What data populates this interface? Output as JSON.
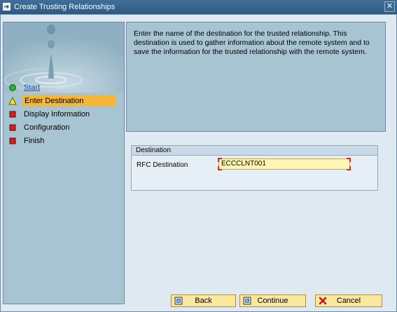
{
  "window": {
    "title": "Create Trusting Relationships",
    "close_symbol": "✕"
  },
  "steps": [
    {
      "label": "Start",
      "state": "link",
      "icon": "green-circle-icon"
    },
    {
      "label": "Enter Destination",
      "state": "active",
      "icon": "yellow-triangle-icon"
    },
    {
      "label": "Display Information",
      "state": "pending",
      "icon": "red-square-icon"
    },
    {
      "label": "Configuration",
      "state": "pending",
      "icon": "red-square-icon"
    },
    {
      "label": "Finish",
      "state": "pending",
      "icon": "red-square-icon"
    }
  ],
  "info": {
    "text": "Enter the name of the destination for the trusted relationship. This destination is used to gather information about the remote system and to save the information for the trusted relationship with the remote system."
  },
  "destination_group": {
    "header": "Destination",
    "rfc_label": "RFC Destination",
    "rfc_value": "ECCCLNT001"
  },
  "buttons": {
    "back": "Back",
    "continue": "Continue",
    "cancel": "Cancel"
  },
  "colors": {
    "active_step": "#f4b73b",
    "panel": "#a7c4d3",
    "button": "#fbe8a0",
    "input": "#fdf5b4"
  }
}
